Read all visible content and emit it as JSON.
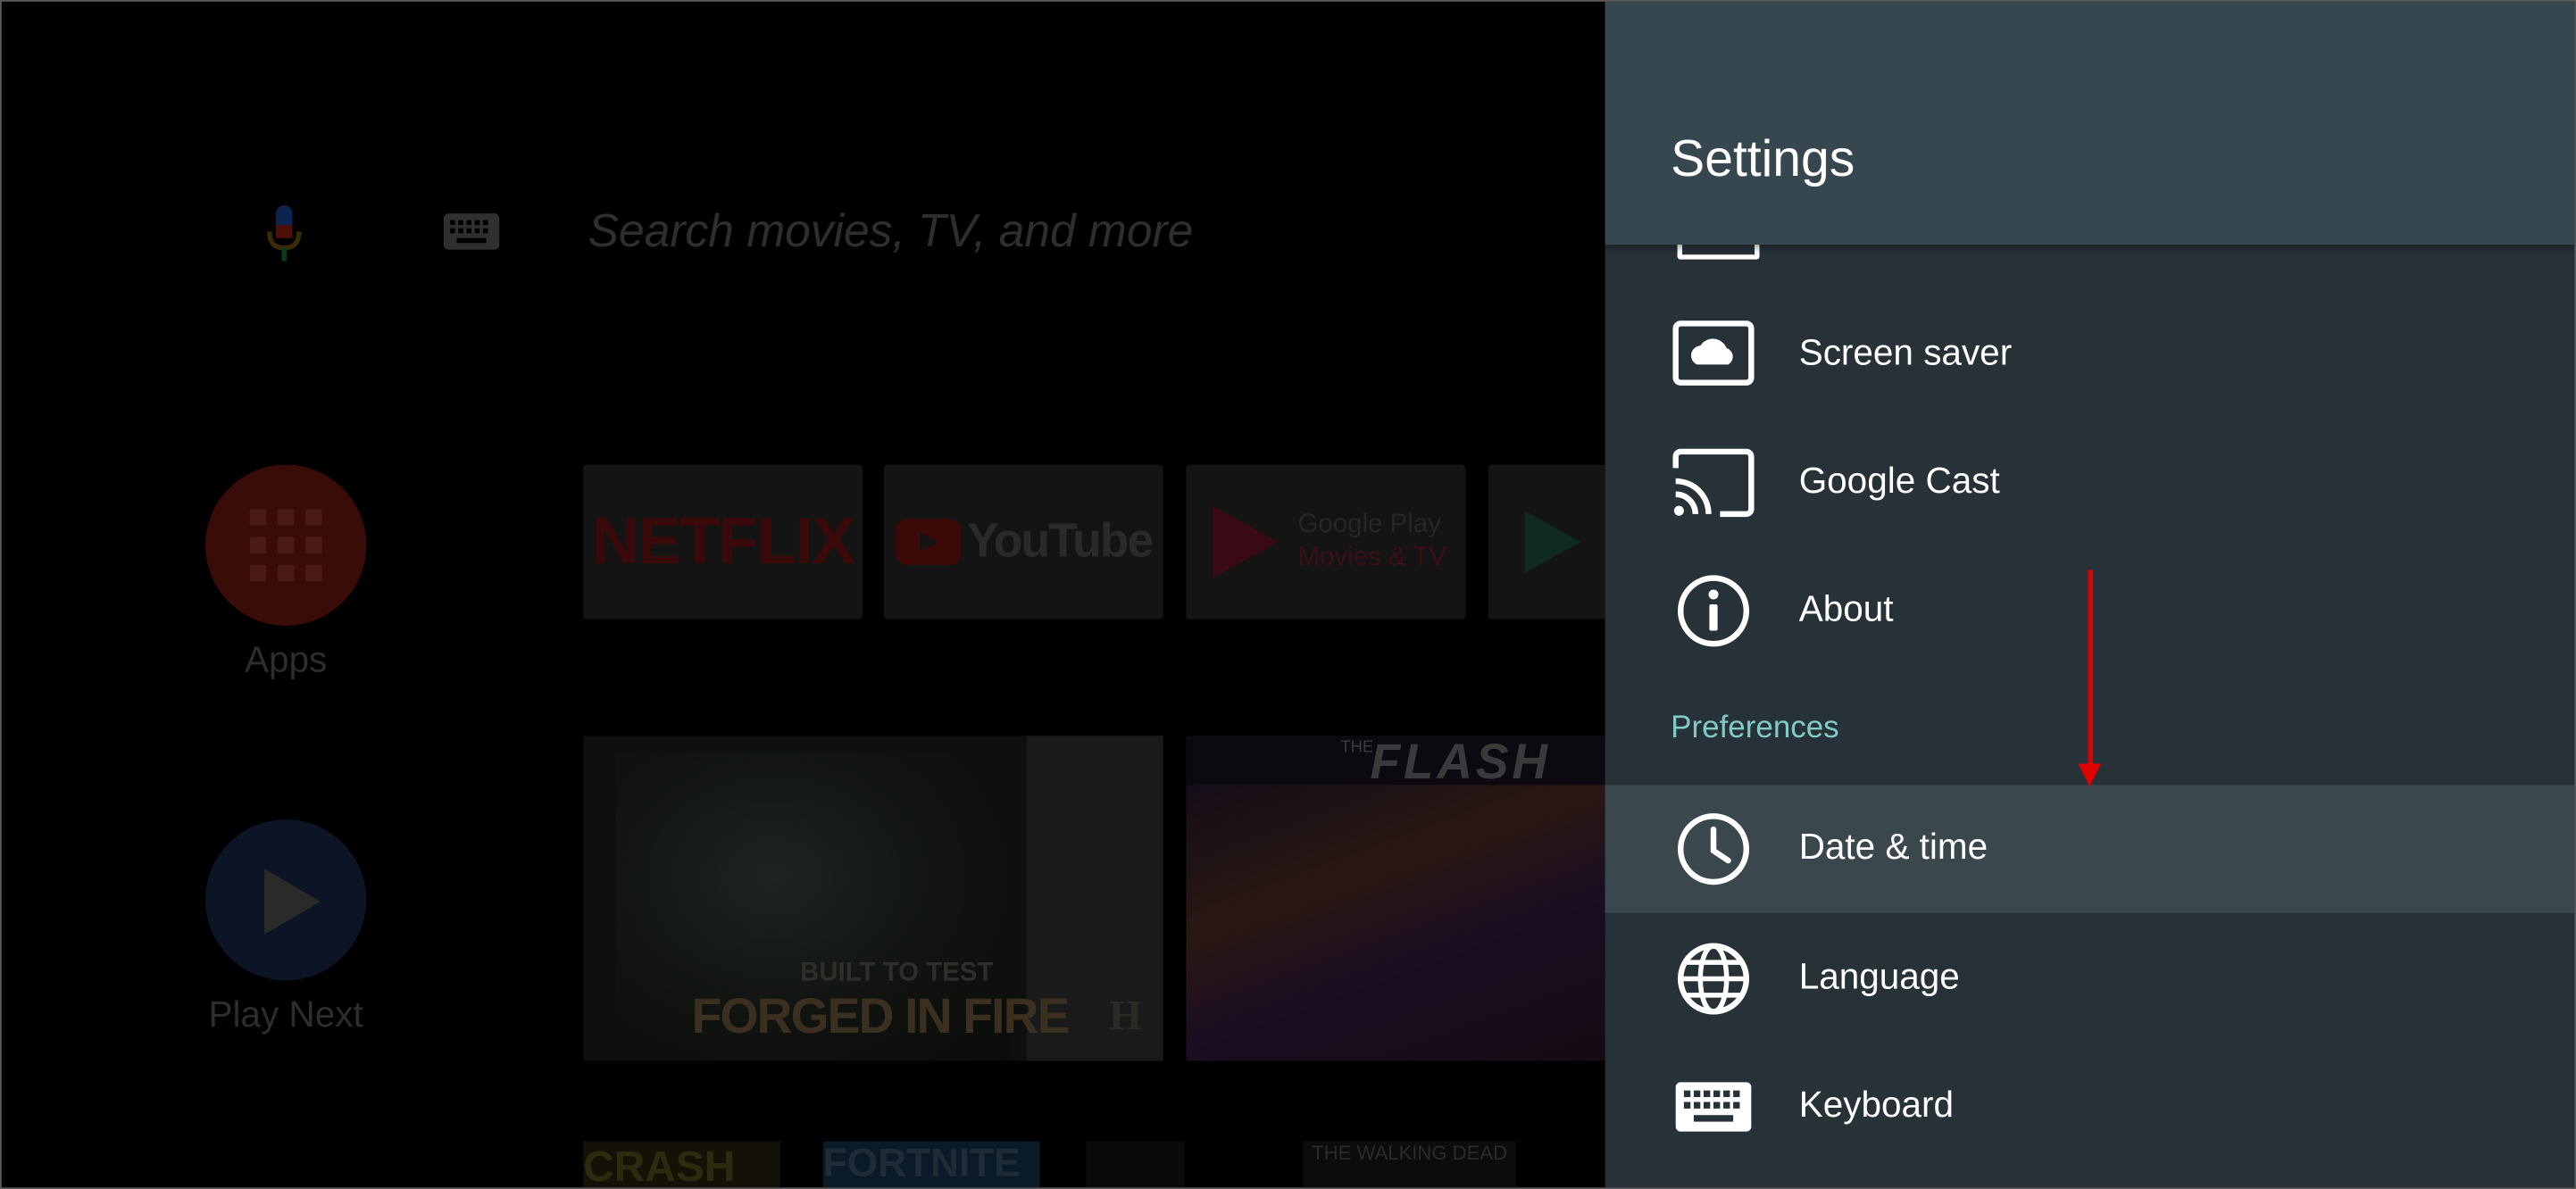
{
  "home": {
    "search_placeholder": "Search movies, TV, and more",
    "apps_label": "Apps",
    "play_next_label": "Play Next",
    "channels": [
      {
        "name": "NETFLIX"
      },
      {
        "name": "YouTube"
      },
      {
        "line1": "Google Play",
        "line2": "Movies & TV"
      },
      {
        "name": "Google Play Store"
      }
    ],
    "cards": {
      "forged_tagline": "BUILT TO TEST",
      "forged_title": "FORGED IN FIRE",
      "forged_network": "H",
      "flash_prefix": "THE",
      "flash_title": "FLASH"
    },
    "bottom_tiles": {
      "crash": "CRASH",
      "fortnite": "FORTNITE",
      "walking_dead": "THE WALKING DEAD"
    }
  },
  "settings": {
    "title": "Settings",
    "items": [
      {
        "label": "Screen saver",
        "icon": "screen-saver-icon"
      },
      {
        "label": "Google Cast",
        "icon": "cast-icon"
      },
      {
        "label": "About",
        "icon": "info-icon"
      }
    ],
    "section_label": "Preferences",
    "pref_items": [
      {
        "label": "Date & time",
        "icon": "clock-icon",
        "selected": true
      },
      {
        "label": "Language",
        "icon": "globe-icon"
      },
      {
        "label": "Keyboard",
        "icon": "keyboard-icon"
      }
    ]
  },
  "colors": {
    "panel_background": "#263238",
    "panel_header": "#37474f",
    "section_accent": "#80cbc4",
    "selected_row": "#3a474d",
    "annotation_arrow": "#e00000"
  }
}
